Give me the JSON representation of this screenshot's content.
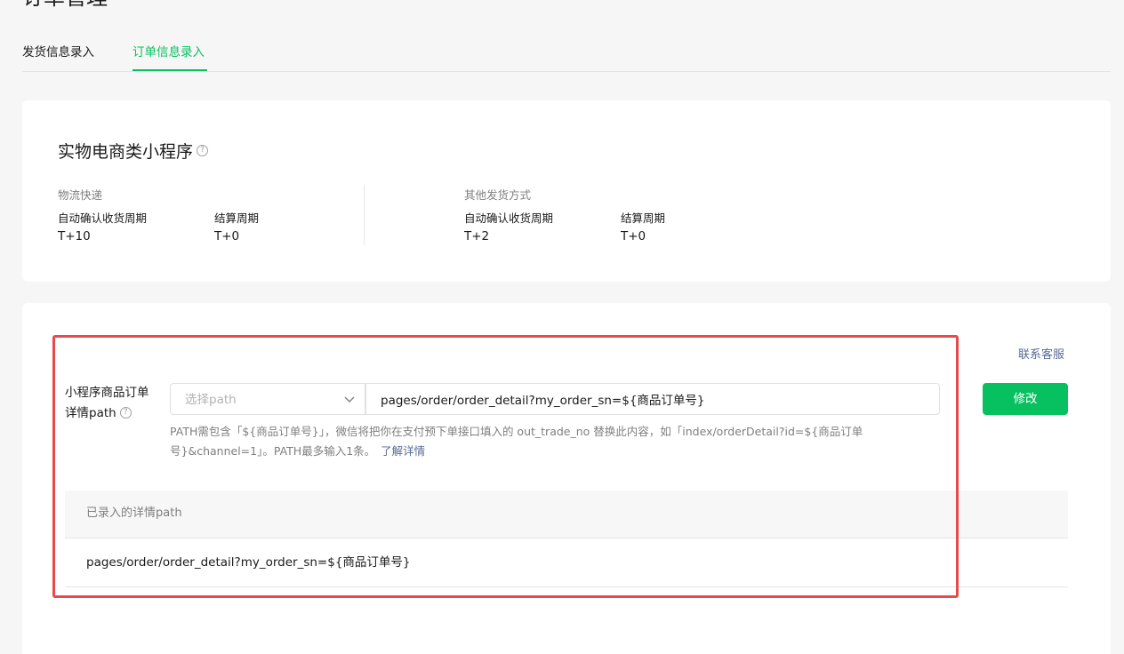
{
  "page": {
    "title": "订单管理"
  },
  "tabs": [
    {
      "label": "发货信息录入",
      "active": false
    },
    {
      "label": "订单信息录入",
      "active": true
    }
  ],
  "category_card": {
    "title": "实物电商类小程序",
    "help_icon": "question-circle-icon",
    "groups": [
      {
        "label": "物流快递",
        "items": [
          {
            "key": "自动确认收货周期",
            "value": "T+10"
          },
          {
            "key": "结算周期",
            "value": "T+0"
          }
        ]
      },
      {
        "label": "其他发货方式",
        "items": [
          {
            "key": "自动确认收货周期",
            "value": "T+2"
          },
          {
            "key": "结算周期",
            "value": "T+0"
          }
        ]
      }
    ]
  },
  "path_card": {
    "contact_link": "联系客服",
    "form_label": "小程序商品订单详情path",
    "form_label_line1": "小程序商品订单",
    "form_label_line2": "详情path",
    "select_placeholder": "选择path",
    "path_value": "pages/order/order_detail?my_order_sn=${商品订单号}",
    "modify_button": "修改",
    "hint_text": "PATH需包含「${商品订单号}」，微信将把你在支付预下单接口填入的 out_trade_no 替换此内容，如「index/orderDetail?id=${商品订单号}&channel=1」。PATH最多输入1条。",
    "hint_link": "了解详情",
    "table_header": "已录入的详情path",
    "table_rows": [
      "pages/order/order_detail?my_order_sn=${商品订单号}"
    ]
  },
  "colors": {
    "brand_green": "#07c160",
    "link_blue": "#576b95",
    "highlight_red": "#e8494c"
  }
}
